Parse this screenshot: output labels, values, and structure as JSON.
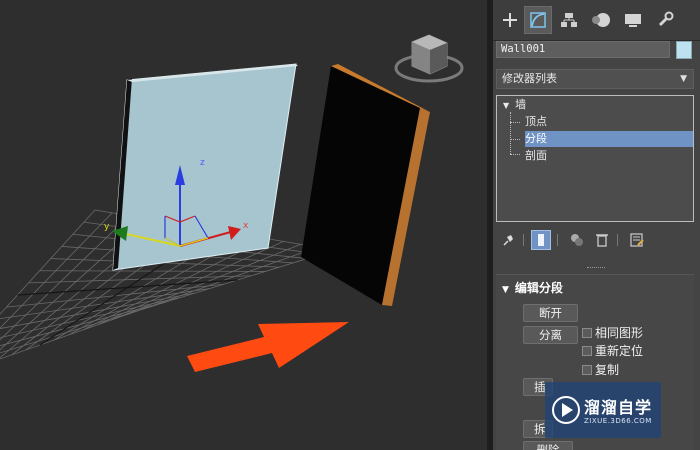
{
  "viewport": {
    "axis_x_label": "x",
    "axis_y_label": "y",
    "axis_z_label": "z",
    "arrow_color": "#ff4a12",
    "wall_color": "#a6c5cf",
    "grid_color": "#6a6a6a"
  },
  "command_panel": {
    "tabs": [
      {
        "name": "create",
        "icon": "plus-icon"
      },
      {
        "name": "modify",
        "icon": "modify-curve-icon",
        "active": true
      },
      {
        "name": "hierarchy",
        "icon": "hierarchy-icon"
      },
      {
        "name": "motion",
        "icon": "motion-icon"
      },
      {
        "name": "display",
        "icon": "display-monitor-icon"
      },
      {
        "name": "utilities",
        "icon": "wrench-icon"
      }
    ],
    "object_name": "Wall001",
    "object_color": "#bde1ee",
    "modifier_list_label": "修改器列表",
    "stack": {
      "root": "墙",
      "items": [
        "顶点",
        "分段",
        "剖面"
      ],
      "selected": "分段"
    },
    "rollout": {
      "title": "编辑分段",
      "buttons": {
        "break": "断开",
        "detach": "分离"
      },
      "checkboxes": [
        "相同图形",
        "重新定位",
        "复制"
      ],
      "partial_buttons": [
        "插",
        "拆",
        "删除"
      ]
    }
  },
  "watermark": {
    "brand": "溜溜自学",
    "url": "ZIXUE.3D66.COM"
  }
}
